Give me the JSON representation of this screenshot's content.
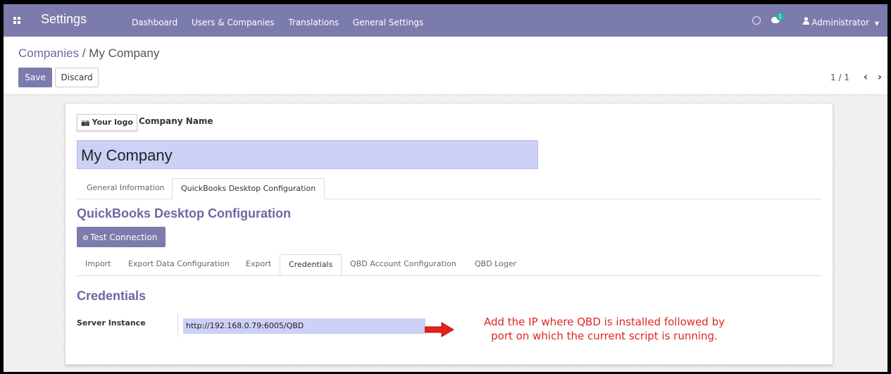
{
  "navbar": {
    "title": "Settings",
    "menu": [
      "Dashboard",
      "Users & Companies",
      "Translations",
      "General Settings"
    ],
    "chat_badge": "1",
    "user": "Administrator"
  },
  "breadcrumb": {
    "parent": "Companies",
    "separator": "/",
    "current": "My Company"
  },
  "buttons": {
    "save": "Save",
    "discard": "Discard"
  },
  "pager": {
    "text": "1 / 1",
    "prev": "‹",
    "next": "›"
  },
  "form": {
    "logo_label": "Your logo",
    "company_name_label": "Company Name",
    "company_name_value": "My Company",
    "tabs": [
      {
        "label": "General Information",
        "active": false
      },
      {
        "label": "QuickBooks Desktop Configuration",
        "active": true
      }
    ],
    "section_title": "QuickBooks Desktop Configuration",
    "test_connection_label": "Test Connection",
    "sub_tabs": [
      {
        "label": "Import",
        "active": false
      },
      {
        "label": "Export Data Configuration",
        "active": false
      },
      {
        "label": "Export",
        "active": false
      },
      {
        "label": "Credentials",
        "active": true
      },
      {
        "label": "QBD Account Configuration",
        "active": false
      },
      {
        "label": "QBD Loger",
        "active": false
      }
    ],
    "credentials_title": "Credentials",
    "server_instance_label": "Server Instance",
    "server_instance_value": "http://192.168.0.79:6005/QBD"
  },
  "annotation": {
    "line1": "Add the IP where QBD is installed followed by",
    "line2": "port on which the current script is running.",
    "color": "#e02424"
  },
  "colors": {
    "primary": "#7c7bad",
    "field_bg": "#cdd0f7",
    "title": "#6b69a2"
  }
}
